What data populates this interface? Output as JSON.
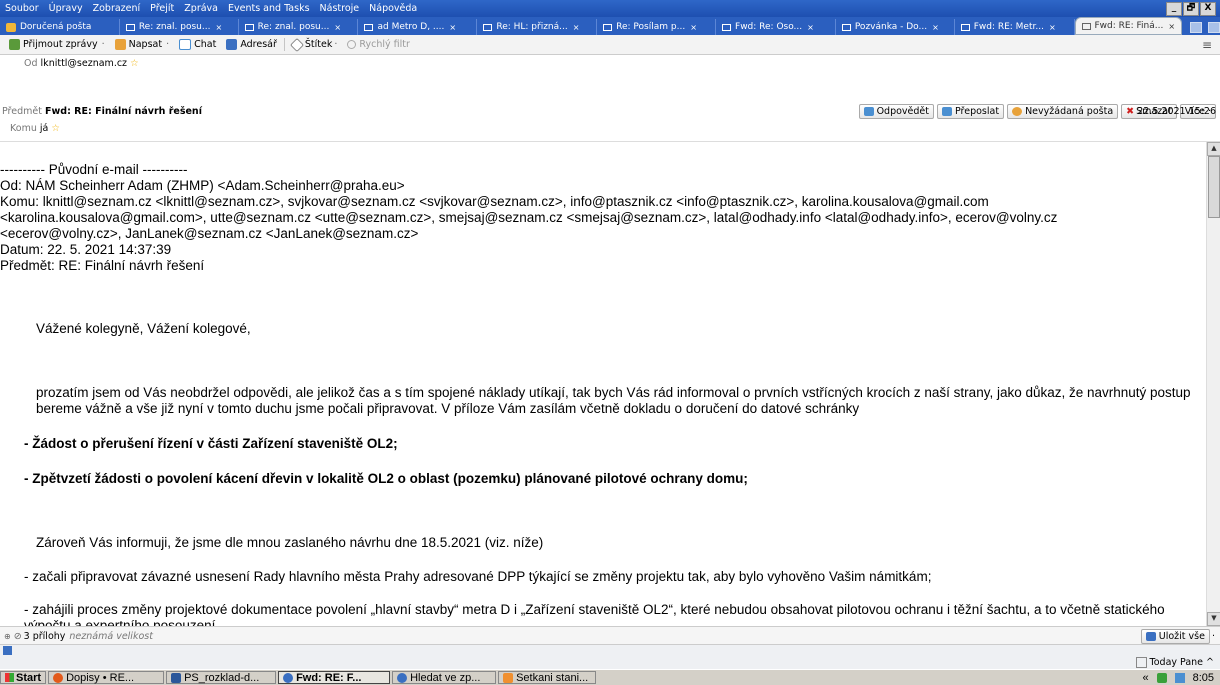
{
  "menubar": {
    "items": [
      "Soubor",
      "Úpravy",
      "Zobrazení",
      "Přejít",
      "Zpráva",
      "Events and Tasks",
      "Nástroje",
      "Nápověda"
    ],
    "window_buttons": [
      "_",
      "🗗",
      "X"
    ]
  },
  "tabs": [
    {
      "label": "Doručená pošta",
      "close": ""
    },
    {
      "label": "Re: znal. posu...",
      "close": "×"
    },
    {
      "label": "Re: znal. posu...",
      "close": "×"
    },
    {
      "label": "ad Metro D, ....",
      "close": "×"
    },
    {
      "label": "Re: HL: přizná...",
      "close": "×"
    },
    {
      "label": "Re: Posílam p...",
      "close": "×"
    },
    {
      "label": "Fwd: Re: Oso...",
      "close": "×"
    },
    {
      "label": "Pozvánka - Do...",
      "close": "×"
    },
    {
      "label": "Fwd: RE: Metr...",
      "close": "×"
    },
    {
      "label": "Fwd: RE: Finá...",
      "close": "×"
    }
  ],
  "toolbar": {
    "get_mail": "Přijmout zprávy",
    "write": "Napsat",
    "chat": "Chat",
    "address_book": "Adresář",
    "tag": "Štítek",
    "quick_filter": "Rychlý filtr",
    "dropdown": "·",
    "menu_icon": "≡"
  },
  "header": {
    "from_label": "Od",
    "from_value": "lknittl@seznam.cz",
    "subject_label": "Předmět",
    "subject_value": "Fwd: RE: Finální návrh řešení",
    "to_label": "Komu",
    "to_value": "já",
    "date": "22.5.2021 15:26",
    "star": "☆",
    "buttons": {
      "reply": "Odpovědět",
      "forward": "Přeposlat",
      "junk": "Nevyžádaná pošta",
      "delete": "Smazat",
      "more": "Více ·"
    }
  },
  "message": {
    "orig_header": "---------- Původní e-mail ----------",
    "from_line": "Od: NÁM Scheinherr Adam (ZHMP) <Adam.Scheinherr@praha.eu>",
    "to_line": "Komu: lknittl@seznam.cz <lknittl@seznam.cz>, svjkovar@seznam.cz <svjkovar@seznam.cz>, info@ptasznik.cz <info@ptasznik.cz>, karolina.kousalova@gmail.com <karolina.kousalova@gmail.com>, utte@seznam.cz <utte@seznam.cz>, smejsaj@seznam.cz <smejsaj@seznam.cz>, latal@odhady.info <latal@odhady.info>, ecerov@volny.cz <ecerov@volny.cz>, JanLanek@seznam.cz <JanLanek@seznam.cz>",
    "date_line": "Datum: 22. 5. 2021 14:37:39",
    "subject_line": "Předmět: RE: Finální návrh řešení",
    "greeting": "Vážené kolegyně, Vážení kolegové,",
    "para1": "prozatím jsem od Vás neobdržel odpovědi, ale jelikož čas a s tím spojené náklady utíkají, tak bych Vás rád informoval o prvních vstřícných krocích z naší strany, jako důkaz, že navrhnutý postup bereme vážně a vše již nyní v tomto duchu jsme počali připravovat. V příloze Vám zasílám včetně dokladu o doručení do datové schránky",
    "bullet1": "-  Žádost o přerušení řízení v části Zařízení staveniště OL2;",
    "bullet2": "-  Zpětvzetí žádosti o povolení kácení dřevin v lokalitě OL2 o oblast (pozemku) plánované pilotové ochrany domu;",
    "para2": "Zároveň Vás informuji, že jsme dle mnou zaslaného návrhu dne 18.5.2021 (viz. níže)",
    "item1": "-  začali připravovat závazné usnesení Rady hlavního města Prahy adresované DPP týkající se změny projektu tak, aby bylo vyhověno Vašim námitkám;",
    "item2": "-  zahájili proces změny projektové dokumentace povolení „hlavní stavby“ metra D i „Zařízení staveniště OL2“, které nebudou obsahovat pilotovou ochranu i těžní šachtu, a to včetně statického výpočtu a expertního posouzení"
  },
  "attachments": {
    "count_label": "3 přílohy",
    "size_label": "neznámá velikost",
    "save_all": "Uložit vše",
    "dropdown": "·"
  },
  "status": {
    "today_pane": "Today Pane",
    "today_arrow": "^"
  },
  "taskbar": {
    "start": "Start",
    "tasks": [
      {
        "label": "Dopisy • RE...",
        "active": false
      },
      {
        "label": "PS_rozklad-d...",
        "active": false
      },
      {
        "label": "Fwd: RE: F...",
        "active": true
      },
      {
        "label": "Hledat ve zp...",
        "active": false
      },
      {
        "label": "Setkani stani...",
        "active": false
      }
    ],
    "tray_arrows": "«",
    "clock": "8:05"
  }
}
